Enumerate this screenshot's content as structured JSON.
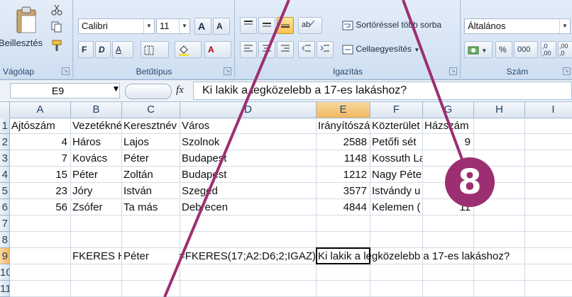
{
  "ribbon": {
    "clipboard": {
      "paste_label": "Beillesztés",
      "group_label": "Vágólap"
    },
    "font": {
      "font_name": "Calibri",
      "font_size": "11",
      "grow_label": "A",
      "shrink_label": "A",
      "bold": "F",
      "italic": "D",
      "underline": "A",
      "color_a": "A",
      "group_label": "Betűtípus"
    },
    "alignment": {
      "wrap_label": "Sortöréssel több sorba",
      "merge_label": "Cellaegyesítés",
      "group_label": "Igazítás"
    },
    "number": {
      "format": "Általános",
      "percent": "%",
      "thousands": "000",
      "inc_dec_a": ",0",
      "inc_dec_b": ",00",
      "dec_dec_a": ",00",
      "dec_dec_b": ",0",
      "group_label": "Szám"
    }
  },
  "formula_bar": {
    "name_box": "E9",
    "fx": "fx",
    "formula": "Ki lakik a legközelebb a 17-es lakáshoz?"
  },
  "columns": [
    "A",
    "B",
    "C",
    "D",
    "E",
    "F",
    "G",
    "H",
    "I"
  ],
  "rows": [
    {
      "num": "1",
      "cells": {
        "A": "Ajtószám",
        "B": "Vezetéknév",
        "C": "Keresztnév",
        "D": "Város",
        "E": "Irányítószám",
        "F": "Közterület",
        "G": "Házszám"
      }
    },
    {
      "num": "2",
      "cells": {
        "A": "4",
        "B": "Háros",
        "C": "Lajos",
        "D": "Szolnok",
        "E": "2588",
        "F": "Petőfi sét",
        "G": "9"
      }
    },
    {
      "num": "3",
      "cells": {
        "A": "7",
        "B": "Kovács",
        "C": "Péter",
        "D": "Budapest",
        "E": "1148",
        "F": "Kossuth La"
      }
    },
    {
      "num": "4",
      "cells": {
        "A": "15",
        "B": "Péter",
        "C": "Zoltán",
        "D": "Budapest",
        "E": "1212",
        "F": "Nagy Péte"
      }
    },
    {
      "num": "5",
      "cells": {
        "A": "23",
        "B": "Jóry",
        "C": "István",
        "D": "Szeged",
        "E": "3577",
        "F": "Istvándy u"
      }
    },
    {
      "num": "6",
      "cells": {
        "A": "56",
        "B": "Zsófer",
        "C": "Ta más",
        "D": "Debrecen",
        "E": "4844",
        "F": "Kelemen (",
        "G": "11"
      }
    },
    {
      "num": "7",
      "cells": {}
    },
    {
      "num": "8",
      "cells": {}
    },
    {
      "num": "9",
      "cells": {
        "B": "FKERES HA",
        "C": "Péter",
        "D": "=FKERES(17;A2:D6;2;IGAZ)",
        "E": "Ki lakik a legközelebb a 17-es lakáshoz?"
      }
    },
    {
      "num": "10",
      "cells": {}
    },
    {
      "num": "11",
      "cells": {}
    }
  ],
  "badge": {
    "text": "8",
    "color": "#9c2f72"
  },
  "colors": {
    "selected_header": "#f1b760",
    "ribbon": "#dfe9f5",
    "annotation_line": "#9c2f72"
  }
}
